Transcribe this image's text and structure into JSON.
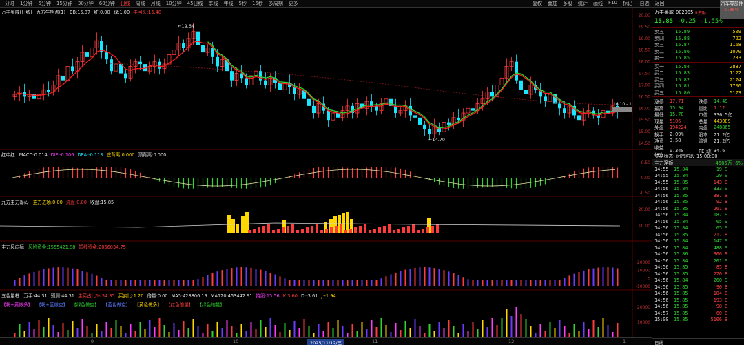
{
  "topbar": {
    "periods": [
      "分时",
      "1分钟",
      "5分钟",
      "15分钟",
      "30分钟",
      "60分钟",
      "日线",
      "周线",
      "月线",
      "10分钟",
      "45日线",
      "季线",
      "年线",
      "5秒",
      "15秒",
      "多周期",
      "更多"
    ],
    "active_period": "日线",
    "tools": [
      "复权",
      "叠加",
      "多股",
      "统计",
      "画线",
      "F10",
      "标记",
      "-自选",
      "返回"
    ],
    "side_button": {
      "label": "汽车零部件",
      "pct": "0.86%"
    }
  },
  "main_header": {
    "stock": "万丰奥威(日线)",
    "indicator": "九方牛熊点(1)",
    "items": [
      {
        "label": "BB:",
        "value": "15.87"
      },
      {
        "label": "红:",
        "value": "0.00"
      },
      {
        "label": "绿:",
        "value": "1.00"
      },
      {
        "label": "牛回头:",
        "value": "16.48"
      }
    ]
  },
  "main_axis": [
    "20.00",
    "19.50",
    "19.00",
    "18.50",
    "18.00",
    "17.50",
    "17.00",
    "16.50",
    "16.00",
    "15.50",
    "15.00",
    "14.50"
  ],
  "annotations": {
    "high": "19.64",
    "low": "14.70",
    "last": "16.10 - 1"
  },
  "macd_header": {
    "name": "红中红",
    "items": [
      {
        "label": "MACD:",
        "value": "0.014"
      },
      {
        "label": "DIF:",
        "value": "-0.106"
      },
      {
        "label": "DEA:",
        "value": "-0.113"
      },
      {
        "label": "底背离:",
        "value": "0.000"
      },
      {
        "label": "顶背离:",
        "value": "0.000"
      }
    ],
    "axis": [
      "0.50",
      "0.00",
      "-0.50"
    ]
  },
  "flow_header": {
    "name": "九方主力筹码",
    "items": [
      {
        "label": "主力进场:",
        "value": "0.00"
      },
      {
        "label": "洗盘:",
        "value": "0.00"
      },
      {
        "label": "收盘:",
        "value": "15.85"
      }
    ],
    "axis": [
      "20.00",
      "10.00"
    ]
  },
  "trend_header": {
    "name": "主力风向标",
    "items": [
      {
        "label": "风险资金:",
        "value": "1555421.88"
      },
      {
        "label": "短线资金:",
        "value": "2066034.75"
      }
    ],
    "axis": [
      "20000",
      "10000",
      "0",
      "-10000"
    ]
  },
  "vol_header": {
    "name": "五色量柱",
    "items": [
      {
        "label": "万手:",
        "value": "44.31"
      },
      {
        "label": "预测:",
        "value": "44.31"
      },
      {
        "label": "主买占比%:",
        "value": "54.35"
      },
      {
        "label": "买卖比:",
        "value": "1.20"
      },
      {
        "label": "倍量:",
        "value": "0.00"
      },
      {
        "label": "MA5:",
        "value": "428806.19"
      },
      {
        "label": "MA120:",
        "value": "453442.91"
      },
      {
        "label": "持股:",
        "value": "15.56"
      },
      {
        "label": "K:",
        "value": "3.60"
      },
      {
        "label": "D:",
        "value": "-3.61"
      },
      {
        "label": "J:",
        "value": "-1.94"
      }
    ],
    "legend": [
      "【粉+黄做多】",
      "【粉+蓝做空】",
      "【绿色做空】",
      "【蓝色做空】",
      "【黄色做多】",
      "【红色倍量】",
      "【绿色缩量】"
    ],
    "axis": [
      "20000",
      "10000"
    ]
  },
  "bottombar": {
    "date": "2025/11/12/三",
    "labels": [
      "9",
      "10",
      "11",
      "12",
      "1"
    ]
  },
  "quote": {
    "name": "万丰奥威",
    "code": "002085",
    "tag": "R资融",
    "price": "15.85",
    "change": "-0.25",
    "pct": "-1.55%"
  },
  "asks": [
    {
      "label": "卖五",
      "price": "15.89",
      "vol": "509"
    },
    {
      "label": "卖四",
      "price": "15.88",
      "vol": "722"
    },
    {
      "label": "卖三",
      "price": "15.87",
      "vol": "1168"
    },
    {
      "label": "卖二",
      "price": "15.86",
      "vol": "1070"
    },
    {
      "label": "卖一",
      "price": "15.85",
      "vol": "233"
    }
  ],
  "bids": [
    {
      "label": "买一",
      "price": "15.84",
      "vol": "2837"
    },
    {
      "label": "买二",
      "price": "15.83",
      "vol": "1122"
    },
    {
      "label": "买三",
      "price": "15.82",
      "vol": "2174"
    },
    {
      "label": "买四",
      "price": "15.81",
      "vol": "1706"
    },
    {
      "label": "买五",
      "price": "15.80",
      "vol": "5173"
    }
  ],
  "stats": [
    {
      "a": "涨停",
      "av": "17.71",
      "ac": "r",
      "b": "跌停",
      "bv": "14.49",
      "bc": "g"
    },
    {
      "a": "最高",
      "av": "15.94",
      "ac": "g",
      "b": "量比",
      "bv": "1.12",
      "bc": "r"
    },
    {
      "a": "最低",
      "av": "15.70",
      "ac": "g",
      "b": "市值",
      "bv": "336.5亿",
      "bc": "w"
    },
    {
      "a": "现量",
      "av": "5106",
      "ac": "r",
      "b": "总量",
      "bv": "443089",
      "bc": "y"
    },
    {
      "a": "外盘",
      "av": "194224",
      "ac": "r",
      "b": "内盘",
      "bv": "248865",
      "bc": "g"
    },
    {
      "a": "换手",
      "av": "2.09%",
      "ac": "w",
      "b": "股本",
      "bv": "21.2亿",
      "bc": "w"
    },
    {
      "a": "净资",
      "av": "3.58",
      "ac": "w",
      "b": "流通",
      "bv": "21.2亿",
      "bc": "w"
    },
    {
      "a": "收益(三)",
      "av": "0.340",
      "ac": "w",
      "b": "PE(动)",
      "bv": "34.6",
      "bc": "w"
    }
  ],
  "trade_state": "交易状态: 闭市阶段 15:00:00",
  "flow_line": {
    "label": "主力净额",
    "value": "-4505万",
    "pct": "-6%"
  },
  "ticks": [
    {
      "t": "14:55",
      "p": "15.84",
      "v": "19",
      "d": "S"
    },
    {
      "t": "14:55",
      "p": "15.84",
      "v": "29",
      "d": "S"
    },
    {
      "t": "14:55",
      "p": "15.85",
      "v": "143",
      "d": "B"
    },
    {
      "t": "14:56",
      "p": "15.84",
      "v": "333",
      "d": "S"
    },
    {
      "t": "14:56",
      "p": "15.85",
      "v": "387",
      "d": "B"
    },
    {
      "t": "14:56",
      "p": "15.85",
      "v": "92",
      "d": "B"
    },
    {
      "t": "14:56",
      "p": "15.85",
      "v": "261",
      "d": "B"
    },
    {
      "t": "14:56",
      "p": "15.84",
      "v": "187",
      "d": "S"
    },
    {
      "t": "14:56",
      "p": "15.84",
      "v": "65",
      "d": "S"
    },
    {
      "t": "14:56",
      "p": "15.84",
      "v": "65",
      "d": "S"
    },
    {
      "t": "14:56",
      "p": "15.85",
      "v": "217",
      "d": "B"
    },
    {
      "t": "14:56",
      "p": "15.84",
      "v": "147",
      "d": "S"
    },
    {
      "t": "14:56",
      "p": "15.84",
      "v": "488",
      "d": "S"
    },
    {
      "t": "14:56",
      "p": "15.86",
      "v": "306",
      "d": "B"
    },
    {
      "t": "14:56",
      "p": "15.84",
      "v": "201",
      "d": "S"
    },
    {
      "t": "14:56",
      "p": "15.85",
      "v": "85",
      "d": "B"
    },
    {
      "t": "14:56",
      "p": "15.85",
      "v": "270",
      "d": "B"
    },
    {
      "t": "14:56",
      "p": "15.84",
      "v": "260",
      "d": "S"
    },
    {
      "t": "14:56",
      "p": "15.85",
      "v": "90",
      "d": "B"
    },
    {
      "t": "14:56",
      "p": "15.85",
      "v": "184",
      "d": "B"
    },
    {
      "t": "14:56",
      "p": "15.85",
      "v": "193",
      "d": "B"
    },
    {
      "t": "14:56",
      "p": "15.85",
      "v": "98",
      "d": "B"
    },
    {
      "t": "14:57",
      "p": "15.85",
      "v": "60",
      "d": "B"
    },
    {
      "t": "15:00",
      "p": "15.85",
      "v": "5106",
      "d": "B"
    }
  ],
  "right_tabs": [
    "日线"
  ],
  "colors": {
    "up": "#ff3b3b",
    "down": "#19e6ff",
    "bg": "#000000",
    "ma": "#ff2020",
    "ma2": "#2fd22f"
  }
}
